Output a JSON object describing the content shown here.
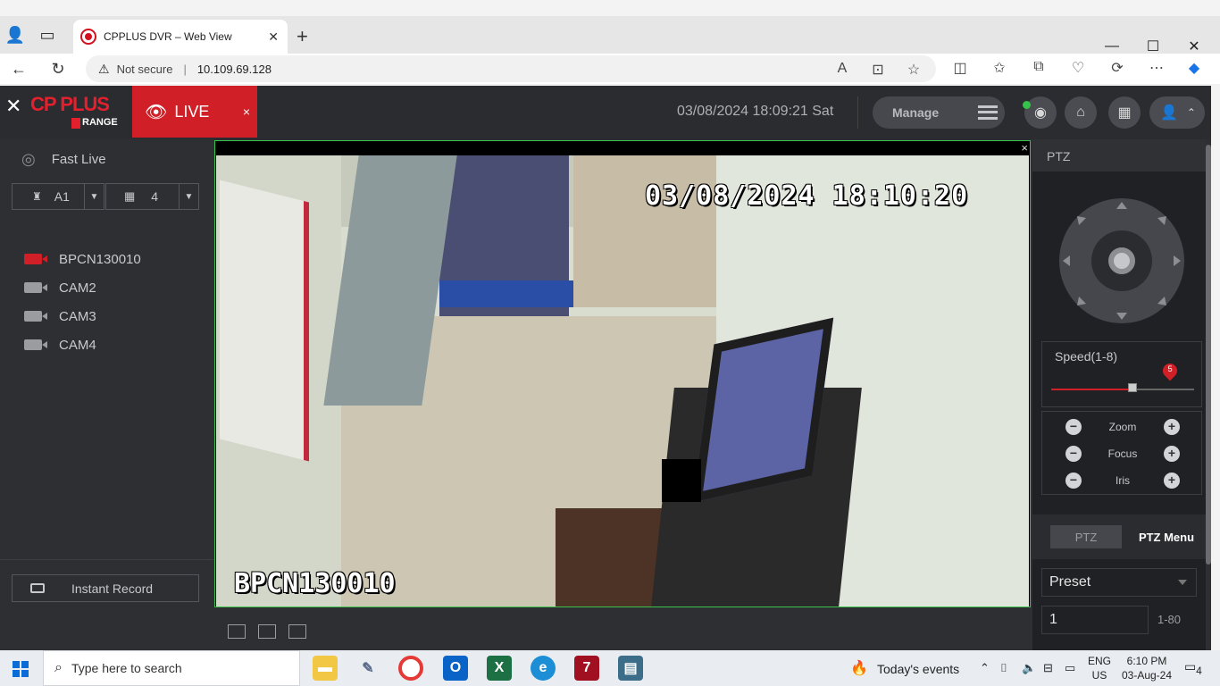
{
  "browser": {
    "tab_title": "CPPLUS DVR – Web View",
    "tab_close": "✕",
    "new_tab": "+",
    "not_secure": "Not secure",
    "url": "10.109.69.128"
  },
  "header": {
    "logo_text": "CP PLUS",
    "logo_sub": "RANGE",
    "live_label": "LIVE",
    "live_close": "×",
    "datetime": "03/08/2024 18:09:21 Sat",
    "manage_label": "Manage"
  },
  "sidebar": {
    "fast_live": "Fast Live",
    "area_select": "A1",
    "layout_select": "4",
    "cameras": [
      {
        "label": "BPCN130010",
        "active": true
      },
      {
        "label": "CAM2",
        "active": false
      },
      {
        "label": "CAM3",
        "active": false
      },
      {
        "label": "CAM4",
        "active": false
      }
    ],
    "instant_record": "Instant Record"
  },
  "video": {
    "osd_datetime": "03/08/2024 18:10:20",
    "osd_name": "BPCN130010",
    "close": "×"
  },
  "ptz": {
    "title": "PTZ",
    "speed_label": "Speed(1-8)",
    "speed_value": "5",
    "speed_fraction": 0.57,
    "zoom": "Zoom",
    "focus": "Focus",
    "iris": "Iris",
    "tab_ptz": "PTZ",
    "tab_menu": "PTZ Menu",
    "preset_label": "Preset",
    "preset_value": "1",
    "preset_range": "1-80"
  },
  "taskbar": {
    "search_placeholder": "Type here to search",
    "events": "Today's events",
    "lang": "ENG",
    "region": "US",
    "time": "6:10 PM",
    "date": "03-Aug-24",
    "notifications": "4"
  },
  "colors": {
    "accent_red": "#d01f26",
    "panel_dark": "#2d2f33",
    "active_border": "#3ac24a"
  }
}
